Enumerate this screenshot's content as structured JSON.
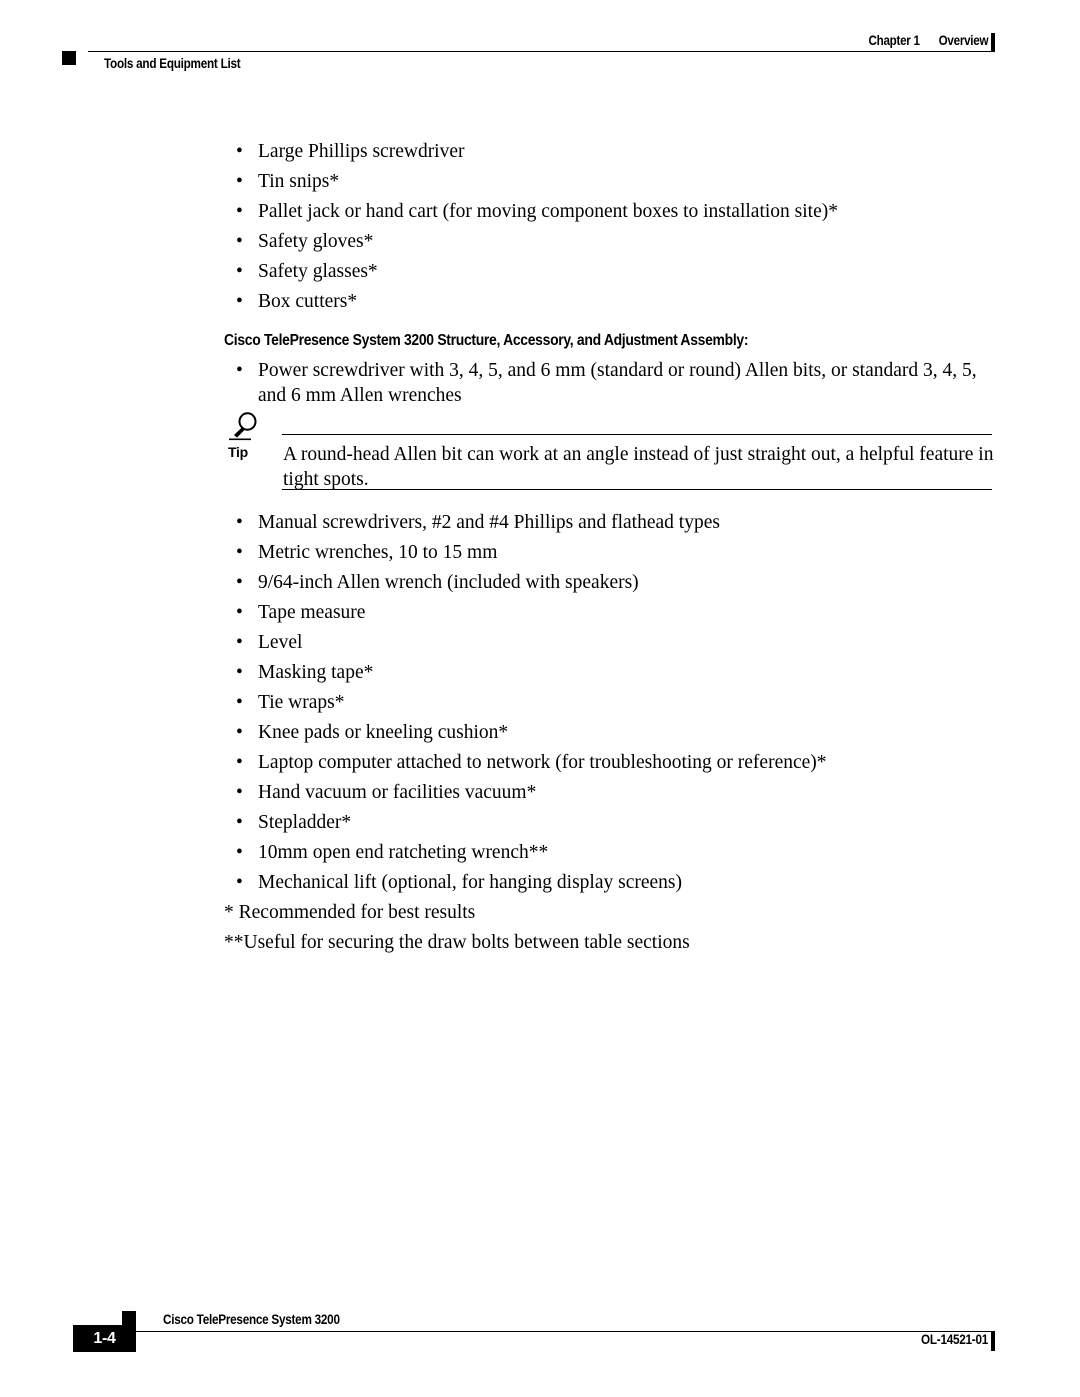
{
  "header": {
    "chapter_label": "Chapter 1",
    "chapter_title": "Overview",
    "section_title": "Tools and Equipment List",
    "marker_icon": "black-square-icon"
  },
  "body": {
    "list_top": [
      "Large Phillips screwdriver",
      "Tin snips*",
      "Pallet jack or hand cart (for moving component boxes to installation site)*",
      "Safety gloves*",
      "Safety glasses*",
      "Box cutters*"
    ],
    "section_heading": "Cisco TelePresence System 3200 Structure, Accessory, and Adjustment Assembly:",
    "list_after_heading": [
      "Power screwdriver with 3, 4, 5, and 6 mm (standard or round) Allen bits, or standard 3, 4, 5, and 6 mm Allen wrenches"
    ],
    "tip": {
      "icon": "tip-lightbulb-icon",
      "label": "Tip",
      "text": "A round-head Allen bit can work at an angle instead of just straight out, a helpful feature in tight spots."
    },
    "list_bottom": [
      "Manual screwdrivers, #2 and #4 Phillips and flathead types",
      "Metric wrenches, 10 to 15 mm",
      "9/64-inch Allen wrench (included with speakers)",
      "Tape measure",
      "Level",
      "Masking tape*",
      "Tie wraps*",
      "Knee pads or kneeling cushion*",
      "Laptop computer attached to network (for troubleshooting or reference)*",
      "Hand vacuum or facilities vacuum*",
      "Stepladder*",
      "10mm open end ratcheting wrench**",
      "Mechanical lift (optional, for hanging display screens)"
    ],
    "footnotes": [
      "* Recommended for best results",
      "**Useful for securing the draw bolts between table sections"
    ]
  },
  "footer": {
    "page_number": "1-4",
    "document_title": "Cisco TelePresence System 3200",
    "document_number": "OL-14521-01",
    "marker_icon": "black-square-icon"
  },
  "colors": {
    "ink": "#000000",
    "paper": "#ffffff"
  }
}
